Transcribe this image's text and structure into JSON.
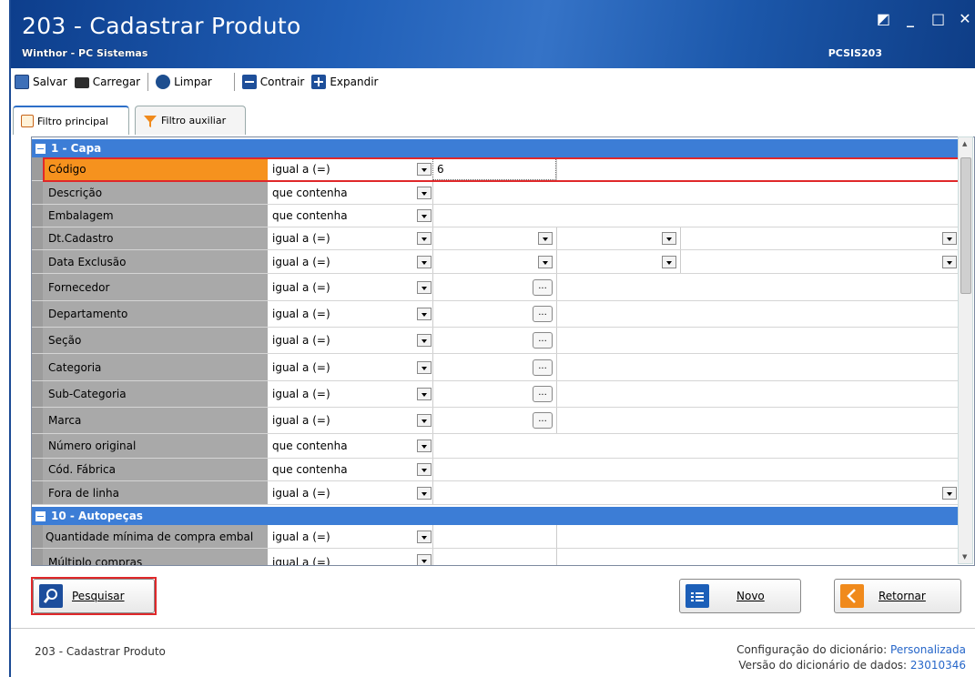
{
  "window": {
    "title": "203 - Cadastrar  Produto",
    "subtitle": "Winthor - PC Sistemas",
    "module_code": "PCSIS203",
    "controls": [
      "◩",
      "_",
      "□",
      "✕"
    ]
  },
  "toolbar": {
    "save": "Salvar",
    "load": "Carregar",
    "clear": "Limpar",
    "collapse": "Contrair",
    "expand": "Expandir"
  },
  "tabs": {
    "main_filter": "Filtro principal",
    "aux_filter": "Filtro auxiliar"
  },
  "sections": [
    {
      "title": "1 - Capa"
    },
    {
      "title": "10 - Autopeças"
    }
  ],
  "rows": [
    {
      "label": "Código",
      "operator": "igual a (=)",
      "value": "6"
    },
    {
      "label": "Descrição",
      "operator": "que contenha",
      "value": ""
    },
    {
      "label": "Embalagem",
      "operator": "que contenha",
      "value": ""
    },
    {
      "label": "Dt.Cadastro",
      "operator": "igual a (=)",
      "value": ""
    },
    {
      "label": "Data Exclusão",
      "operator": "igual a (=)",
      "value": ""
    },
    {
      "label": "Fornecedor",
      "operator": "igual a (=)",
      "value": ""
    },
    {
      "label": "Departamento",
      "operator": "igual a (=)",
      "value": ""
    },
    {
      "label": "Seção",
      "operator": "igual a (=)",
      "value": ""
    },
    {
      "label": "Categoria",
      "operator": "igual a (=)",
      "value": ""
    },
    {
      "label": "Sub-Categoria",
      "operator": "igual a (=)",
      "value": ""
    },
    {
      "label": "Marca",
      "operator": "igual a (=)",
      "value": ""
    },
    {
      "label": "Número original",
      "operator": "que contenha",
      "value": ""
    },
    {
      "label": "Cód. Fábrica",
      "operator": "que contenha",
      "value": ""
    },
    {
      "label": "Fora de linha",
      "operator": "igual a (=)",
      "value": ""
    },
    {
      "label": "Quantidade mínima de compra embal",
      "operator": "igual a (=)",
      "value": ""
    },
    {
      "label": "Múltiplo compras",
      "operator": "igual a (=)",
      "value": ""
    }
  ],
  "ellipsis": "...",
  "buttons": {
    "search": "Pesquisar",
    "new": "Novo",
    "back": "Retornar"
  },
  "footer": {
    "left": "203 - Cadastrar  Produto",
    "config_label": "Configuração do dicionário:",
    "config_value": "Personalizada",
    "version_label": "Versão do dicionário de dados:",
    "version_value": "23010346"
  },
  "colors": {
    "title_bar": "#1c58ab",
    "section": "#3c7dd6",
    "active_row": "#f6921e",
    "highlight": "#e0282a"
  }
}
